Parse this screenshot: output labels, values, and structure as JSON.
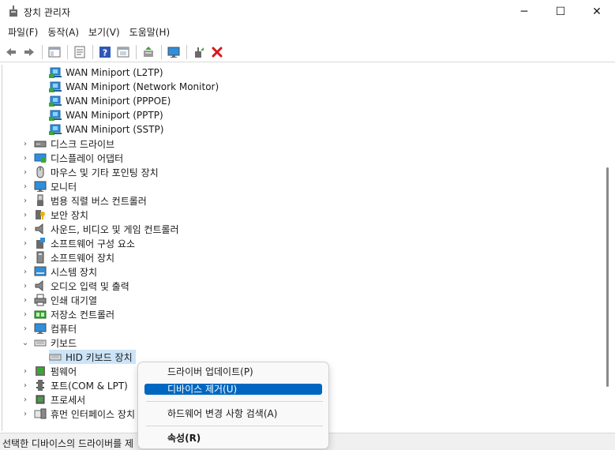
{
  "window": {
    "title": "장치 관리자",
    "minimize_glyph": "─",
    "maximize_glyph": "☐",
    "close_glyph": "✕"
  },
  "menubar": {
    "items": [
      "파일(F)",
      "동작(A)",
      "보기(V)",
      "도움말(H)"
    ]
  },
  "toolbar": {
    "buttons": [
      "back-icon",
      "forward-icon",
      "show-hide-tree-icon",
      "properties-icon",
      "help-icon",
      "view-icon",
      "update-driver-icon",
      "scan-hardware-icon",
      "enable-device-icon",
      "uninstall-device-icon"
    ]
  },
  "tree": {
    "rows": [
      {
        "label": "WAN Miniport (L2TP)",
        "icon": "network-adapter-icon",
        "level": 2
      },
      {
        "label": "WAN Miniport (Network Monitor)",
        "icon": "network-adapter-icon",
        "level": 2
      },
      {
        "label": "WAN Miniport (PPPOE)",
        "icon": "network-adapter-icon",
        "level": 2
      },
      {
        "label": "WAN Miniport (PPTP)",
        "icon": "network-adapter-icon",
        "level": 2
      },
      {
        "label": "WAN Miniport (SSTP)",
        "icon": "network-adapter-icon",
        "level": 2
      },
      {
        "label": "디스크 드라이브",
        "icon": "disk-drive-icon",
        "level": 1,
        "chevron": "›"
      },
      {
        "label": "디스플레이 어댑터",
        "icon": "display-adapter-icon",
        "level": 1,
        "chevron": "›"
      },
      {
        "label": "마우스 및 기타 포인팅 장치",
        "icon": "mouse-icon",
        "level": 1,
        "chevron": "›"
      },
      {
        "label": "모니터",
        "icon": "monitor-icon",
        "level": 1,
        "chevron": "›"
      },
      {
        "label": "범용 직렬 버스 컨트롤러",
        "icon": "usb-icon",
        "level": 1,
        "chevron": "›"
      },
      {
        "label": "보안 장치",
        "icon": "security-device-icon",
        "level": 1,
        "chevron": "›"
      },
      {
        "label": "사운드, 비디오 및 게임 컨트롤러",
        "icon": "speaker-icon",
        "level": 1,
        "chevron": "›"
      },
      {
        "label": "소프트웨어 구성 요소",
        "icon": "software-component-icon",
        "level": 1,
        "chevron": "›"
      },
      {
        "label": "소프트웨어 장치",
        "icon": "software-device-icon",
        "level": 1,
        "chevron": "›"
      },
      {
        "label": "시스템 장치",
        "icon": "system-device-icon",
        "level": 1,
        "chevron": "›"
      },
      {
        "label": "오디오 입력 및 출력",
        "icon": "speaker-icon",
        "level": 1,
        "chevron": "›"
      },
      {
        "label": "인쇄 대기열",
        "icon": "printer-icon",
        "level": 1,
        "chevron": "›"
      },
      {
        "label": "저장소 컨트롤러",
        "icon": "storage-controller-icon",
        "level": 1,
        "chevron": "›"
      },
      {
        "label": "컴퓨터",
        "icon": "computer-icon",
        "level": 1,
        "chevron": "›"
      },
      {
        "label": "키보드",
        "icon": "keyboard-icon",
        "level": 1,
        "chevron": "⌄"
      },
      {
        "label": "HID 키보드 장치",
        "icon": "keyboard-icon",
        "level": 2,
        "selected": true
      },
      {
        "label": "펌웨어",
        "icon": "firmware-icon",
        "level": 1,
        "chevron": "›"
      },
      {
        "label": "포트(COM & LPT)",
        "icon": "port-icon",
        "level": 1,
        "chevron": "›"
      },
      {
        "label": "프로세서",
        "icon": "processor-icon",
        "level": 1,
        "chevron": "›"
      },
      {
        "label": "휴먼 인터페이스 장치",
        "icon": "hid-icon",
        "level": 1,
        "chevron": "›"
      }
    ]
  },
  "context_menu": {
    "update_driver": "드라이버 업데이트(P)",
    "uninstall_device": "디바이스 제거(U)",
    "scan_hardware": "하드웨어 변경 사항 검색(A)",
    "properties": "속성(R)"
  },
  "statusbar": {
    "text": "선택한 디바이스의 드라이버를 제"
  },
  "colors": {
    "selection": "#cce4f7",
    "menu_highlight": "#0067c0",
    "uninstall_red": "#d9161c",
    "network_green": "#3aa832",
    "monitor_blue": "#2f8fdc"
  }
}
